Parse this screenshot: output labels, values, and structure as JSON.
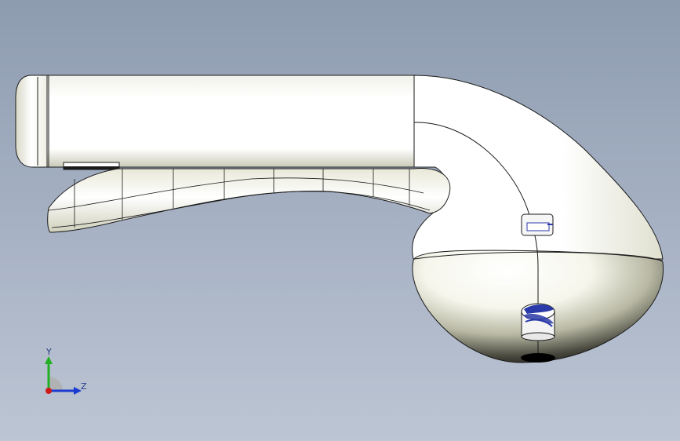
{
  "viewport": {
    "background_top": "#8e9cb0",
    "background_bottom": "#bcc5d3"
  },
  "model": {
    "body_color": "#ffffff",
    "shadow_color": "#000000",
    "edge_color": "#1a1a1a",
    "insert_accent_color": "#2a3aa8"
  },
  "triad": {
    "y_label": "Y",
    "z_label": "Z",
    "y_color": "#22b022",
    "z_color": "#1a3ad0",
    "x_color": "#d01a1a"
  }
}
